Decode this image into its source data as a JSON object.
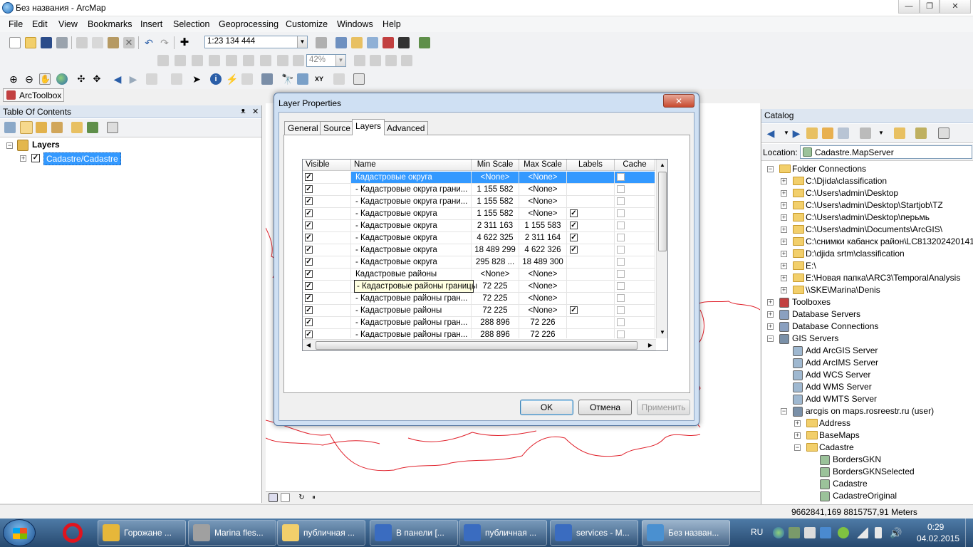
{
  "window": {
    "title": "Без названия - ArcMap",
    "minimize": "—",
    "maximize": "❐",
    "close": "✕"
  },
  "menu": [
    "File",
    "Edit",
    "View",
    "Bookmarks",
    "Insert",
    "Selection",
    "Geoprocessing",
    "Customize",
    "Windows",
    "Help"
  ],
  "toolbar": {
    "scale_value": "1:23 134 444",
    "zoom_percent": "42%",
    "arctoolbox_label": "ArcToolbox"
  },
  "toc": {
    "title": "Table Of Contents",
    "root": "Layers",
    "layer": "Cadastre/Cadastre",
    "pin": "ᴥ",
    "close": "✕"
  },
  "dialog": {
    "title": "Layer Properties",
    "tabs": [
      "General",
      "Source",
      "Layers",
      "Advanced"
    ],
    "columns": [
      "Visible",
      "Name",
      "Min Scale",
      "Max Scale",
      "Labels",
      "Cache"
    ],
    "rows": [
      {
        "visible": true,
        "name": "Кадастровые округа",
        "min": "<None>",
        "max": "<None>",
        "labels": false
      },
      {
        "visible": true,
        "name": "  - Кадастровые округа грани...",
        "min": "1 155 582",
        "max": "<None>",
        "labels": false
      },
      {
        "visible": true,
        "name": "  - Кадастровые округа грани...",
        "min": "1 155 582",
        "max": "<None>",
        "labels": false
      },
      {
        "visible": true,
        "name": "  - Кадастровые округа",
        "min": "1 155 582",
        "max": "<None>",
        "labels": true
      },
      {
        "visible": true,
        "name": "  - Кадастровые округа",
        "min": "2 311 163",
        "max": "1 155 583",
        "labels": true
      },
      {
        "visible": true,
        "name": "  - Кадастровые округа",
        "min": "4 622 325",
        "max": "2 311 164",
        "labels": true
      },
      {
        "visible": true,
        "name": "  - Кадастровые округа",
        "min": "18 489 299",
        "max": "4 622 326",
        "labels": true
      },
      {
        "visible": true,
        "name": "  - Кадастровые округа",
        "min": "295 828 ...",
        "max": "18 489 300",
        "labels": false
      },
      {
        "visible": true,
        "name": "Кадастровые районы",
        "min": "<None>",
        "max": "<None>",
        "labels": false
      },
      {
        "visible": true,
        "name": "  - Кадастровые районы границы",
        "min": "72 225",
        "max": "<None>",
        "labels": false
      },
      {
        "visible": true,
        "name": "  - Кадастровые районы гран...",
        "min": "72 225",
        "max": "<None>",
        "labels": false
      },
      {
        "visible": true,
        "name": "  - Кадастровые районы",
        "min": "72 225",
        "max": "<None>",
        "labels": true
      },
      {
        "visible": true,
        "name": "  - Кадастровые районы гран...",
        "min": "288 896",
        "max": "72 226",
        "labels": false
      },
      {
        "visible": true,
        "name": "  - Кадастровые районы гран...",
        "min": "288 896",
        "max": "72 226",
        "labels": false
      }
    ],
    "tooltip": "- Кадастровые районы границы",
    "ok": "OK",
    "cancel": "Отмена",
    "apply": "Применить",
    "close": "✕"
  },
  "catalog": {
    "title": "Catalog",
    "location_label": "Location:",
    "location_value": "Cadastre.MapServer",
    "items": [
      {
        "level": 0,
        "text": "Folder Connections",
        "exp": "−",
        "icon": "folder"
      },
      {
        "level": 1,
        "text": "C:\\Djida\\classification",
        "exp": "+",
        "icon": "folder"
      },
      {
        "level": 1,
        "text": "C:\\Users\\admin\\Desktop",
        "exp": "+",
        "icon": "folder"
      },
      {
        "level": 1,
        "text": "C:\\Users\\admin\\Desktop\\Startjob\\TZ",
        "exp": "+",
        "icon": "folder"
      },
      {
        "level": 1,
        "text": "C:\\Users\\admin\\Desktop\\перьмь",
        "exp": "+",
        "icon": "folder"
      },
      {
        "level": 1,
        "text": "C:\\Users\\admin\\Documents\\ArcGIS\\",
        "exp": "+",
        "icon": "folder"
      },
      {
        "level": 1,
        "text": "C:\\снимки кабанск район\\LC813202420141",
        "exp": "+",
        "icon": "folder"
      },
      {
        "level": 1,
        "text": "D:\\djida srtm\\classification",
        "exp": "+",
        "icon": "folder"
      },
      {
        "level": 1,
        "text": "E:\\",
        "exp": "+",
        "icon": "folder"
      },
      {
        "level": 1,
        "text": "E:\\Новая папка\\ARC3\\TemporalAnalysis",
        "exp": "+",
        "icon": "folder"
      },
      {
        "level": 1,
        "text": "\\\\SKE\\Marina\\Denis",
        "exp": "+",
        "icon": "folder"
      },
      {
        "level": 0,
        "text": "Toolboxes",
        "exp": "+",
        "icon": "toolbox"
      },
      {
        "level": 0,
        "text": "Database Servers",
        "exp": "+",
        "icon": "db"
      },
      {
        "level": 0,
        "text": "Database Connections",
        "exp": "+",
        "icon": "db"
      },
      {
        "level": 0,
        "text": "GIS Servers",
        "exp": "−",
        "icon": "server"
      },
      {
        "level": 1,
        "text": "Add ArcGIS Server",
        "exp": "",
        "icon": "add"
      },
      {
        "level": 1,
        "text": "Add ArcIMS Server",
        "exp": "",
        "icon": "add"
      },
      {
        "level": 1,
        "text": "Add WCS Server",
        "exp": "",
        "icon": "add"
      },
      {
        "level": 1,
        "text": "Add WMS Server",
        "exp": "",
        "icon": "add"
      },
      {
        "level": 1,
        "text": "Add WMTS Server",
        "exp": "",
        "icon": "add"
      },
      {
        "level": 1,
        "text": "arcgis on maps.rosreestr.ru (user)",
        "exp": "−",
        "icon": "server"
      },
      {
        "level": 2,
        "text": "Address",
        "exp": "+",
        "icon": "folder"
      },
      {
        "level": 2,
        "text": "BaseMaps",
        "exp": "+",
        "icon": "folder"
      },
      {
        "level": 2,
        "text": "Cadastre",
        "exp": "−",
        "icon": "folder"
      },
      {
        "level": 3,
        "text": "BordersGKN",
        "exp": "",
        "icon": "map"
      },
      {
        "level": 3,
        "text": "BordersGKNSelected",
        "exp": "",
        "icon": "map"
      },
      {
        "level": 3,
        "text": "Cadastre",
        "exp": "",
        "icon": "map"
      },
      {
        "level": 3,
        "text": "CadastreOriginal",
        "exp": "",
        "icon": "map"
      }
    ]
  },
  "status": {
    "coords": "9662841,169  8815757,91 Meters"
  },
  "taskbar": {
    "items": [
      "Горожане ...",
      "Marina fles...",
      "публичная ...",
      "В панели [...",
      "публичная ...",
      "services - M...",
      "Без назван..."
    ],
    "lang": "RU",
    "time": "0:29",
    "date": "04.02.2015"
  },
  "colors": {
    "map_line": "#e0202a",
    "selection": "#3399ff",
    "taskbar": "#3b6590"
  }
}
